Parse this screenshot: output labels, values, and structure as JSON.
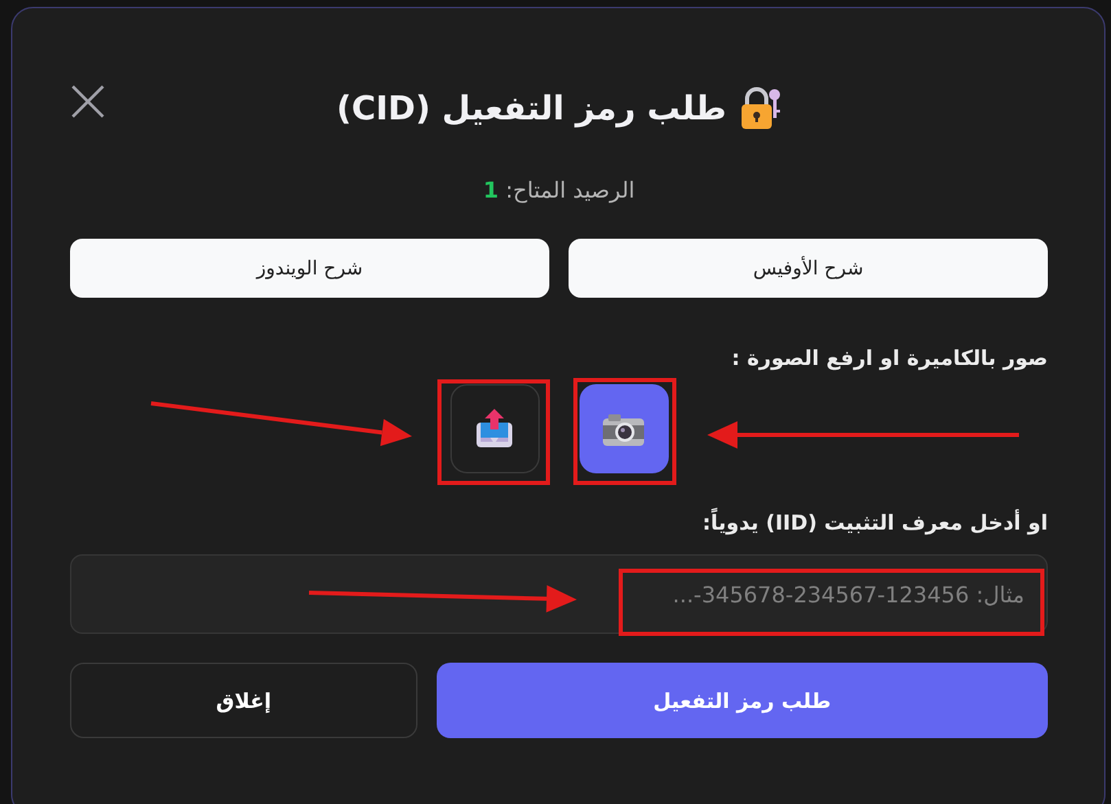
{
  "dialog": {
    "title": "طلب رمز التفعيل (CID)",
    "balance": {
      "label": "الرصيد المتاح:",
      "value": "1"
    },
    "guide_buttons": [
      "شرح الأوفيس",
      "شرح الويندوز"
    ],
    "photo_label": "صور بالكاميرة او ارفع الصورة :",
    "photo_buttons": [
      {
        "kind": "camera",
        "selected": true
      },
      {
        "kind": "upload",
        "selected": false
      }
    ],
    "iid_label": "او أدخل معرف التثبيت (IID) يدوياً:",
    "iid_field": {
      "placeholder": "مثال: 123456-234567-345678-..."
    },
    "actions": [
      {
        "label": "طلب رمز التفعيل",
        "kind": "primary"
      },
      {
        "label": "إغلاق",
        "kind": "secondary"
      }
    ]
  }
}
